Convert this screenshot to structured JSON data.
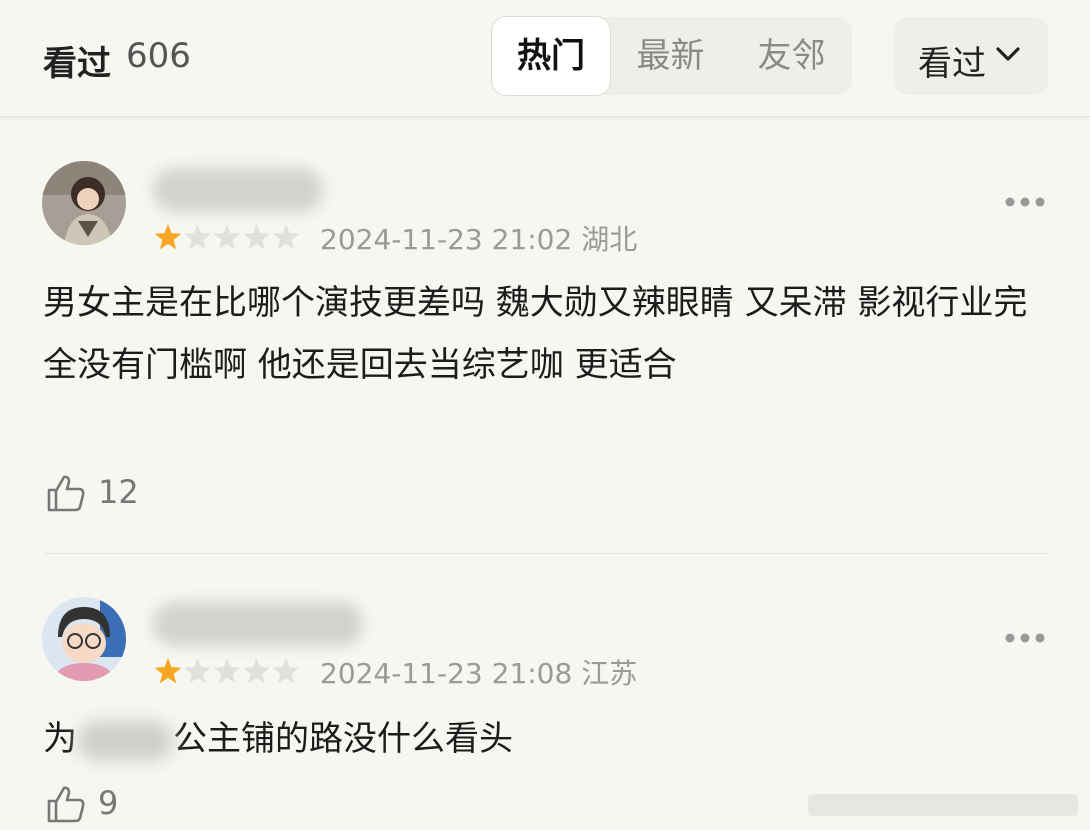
{
  "header": {
    "title": "看过",
    "count": "606",
    "tabs": [
      {
        "label": "热门",
        "active": true
      },
      {
        "label": "最新",
        "active": false
      },
      {
        "label": "友邻",
        "active": false
      }
    ],
    "filter_label": "看过",
    "filter_icon": "chevron-down-icon"
  },
  "colors": {
    "star_active": "#f5a623",
    "star_inactive": "#e0e0dc",
    "meta_text": "#9a9a96",
    "background": "#f7f7f2"
  },
  "comments": [
    {
      "rating": 1,
      "max_rating": 5,
      "date": "2024-11-23 21:02",
      "location": "湖北",
      "text": "男女主是在比哪个演技更差吗  魏大勋又辣眼睛  又呆滞  影视行业完全没有门槛啊  他还是回去当综艺咖 更适合",
      "likes": "12"
    },
    {
      "rating": 1,
      "max_rating": 5,
      "date": "2024-11-23 21:08",
      "location": "江苏",
      "text_prefix": "为",
      "text_suffix": "公主铺的路没什么看头",
      "likes": "9"
    }
  ]
}
